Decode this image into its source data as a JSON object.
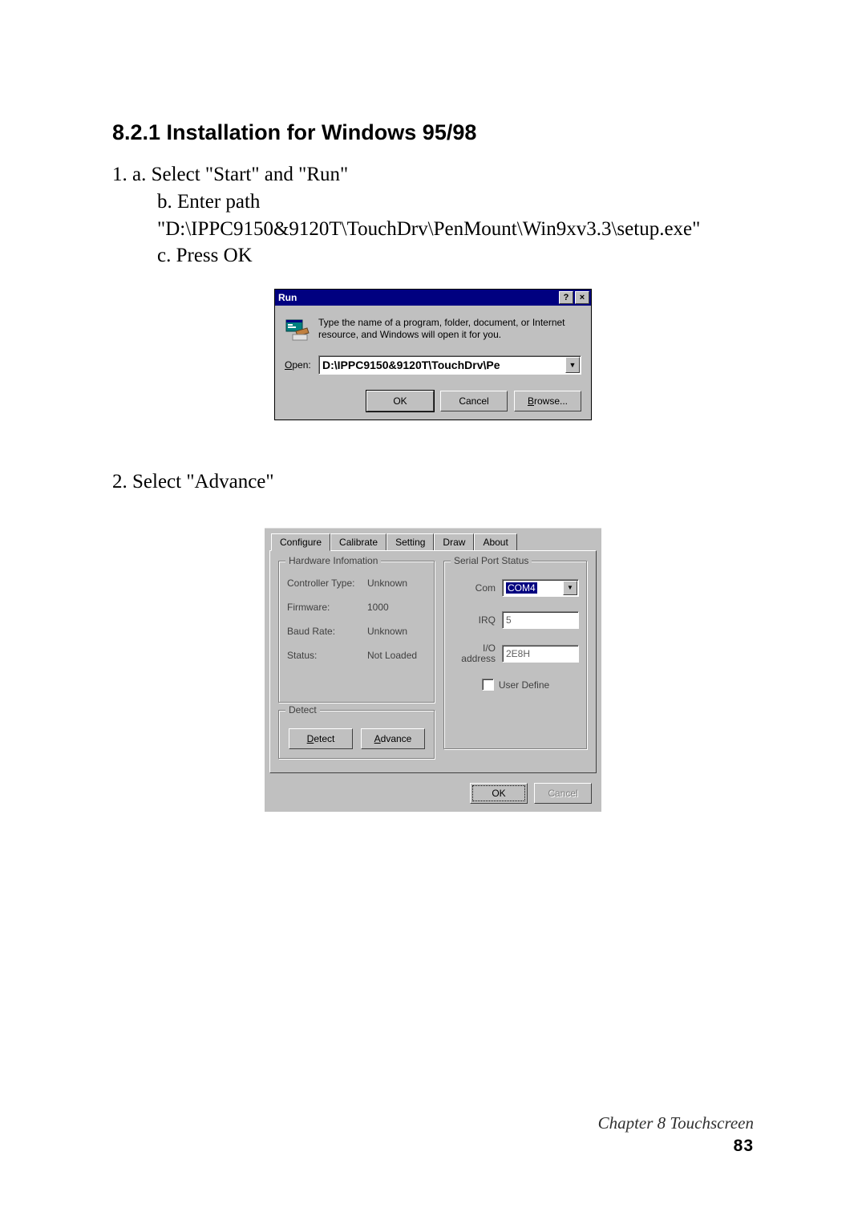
{
  "heading": "8.2.1 Installation for Windows 95/98",
  "step1": {
    "intro": "1. a. Select \"Start\" and \"Run\"",
    "b": "b. Enter path",
    "path": "\"D:\\IPPC9150&9120T\\TouchDrv\\PenMount\\Win9xv3.3\\setup.exe\"",
    "c": "c. Press OK"
  },
  "run_dialog": {
    "title": "Run",
    "help_btn": "?",
    "close_btn": "×",
    "description": "Type the name of a program, folder, document, or Internet resource, and Windows will open it for you.",
    "open_label_underline": "O",
    "open_label_rest": "pen:",
    "open_value": "D:\\IPPC9150&9120T\\TouchDrv\\Pe",
    "buttons": {
      "ok": "OK",
      "cancel": "Cancel",
      "browse_u": "B",
      "browse_rest": "rowse..."
    }
  },
  "step2": "2. Select \"Advance\"",
  "config_dialog": {
    "tabs": [
      "Configure",
      "Calibrate",
      "Setting",
      "Draw",
      "About"
    ],
    "hw_group_title": "Hardware Infomation",
    "hw": {
      "controller_type_k": "Controller Type:",
      "controller_type_v": "Unknown",
      "firmware_k": "Firmware:",
      "firmware_v": "1000",
      "baud_k": "Baud Rate:",
      "baud_v": "Unknown",
      "status_k": "Status:",
      "status_v": "Not Loaded"
    },
    "detect_group_title": "Detect",
    "detect_btn_u": "D",
    "detect_btn_rest": "etect",
    "advance_btn_u": "A",
    "advance_btn_rest": "dvance",
    "sp_group_title": "Serial Port Status",
    "sp": {
      "com_k": "Com",
      "com_v": "COM4",
      "irq_k": "IRQ",
      "irq_v": "5",
      "io_k": "I/O address",
      "io_v": "2E8H"
    },
    "user_define": "User Define",
    "ok": "OK",
    "cancel": "Cancel"
  },
  "footer": {
    "chapter": "Chapter 8   Touchscreen",
    "page": "83"
  }
}
